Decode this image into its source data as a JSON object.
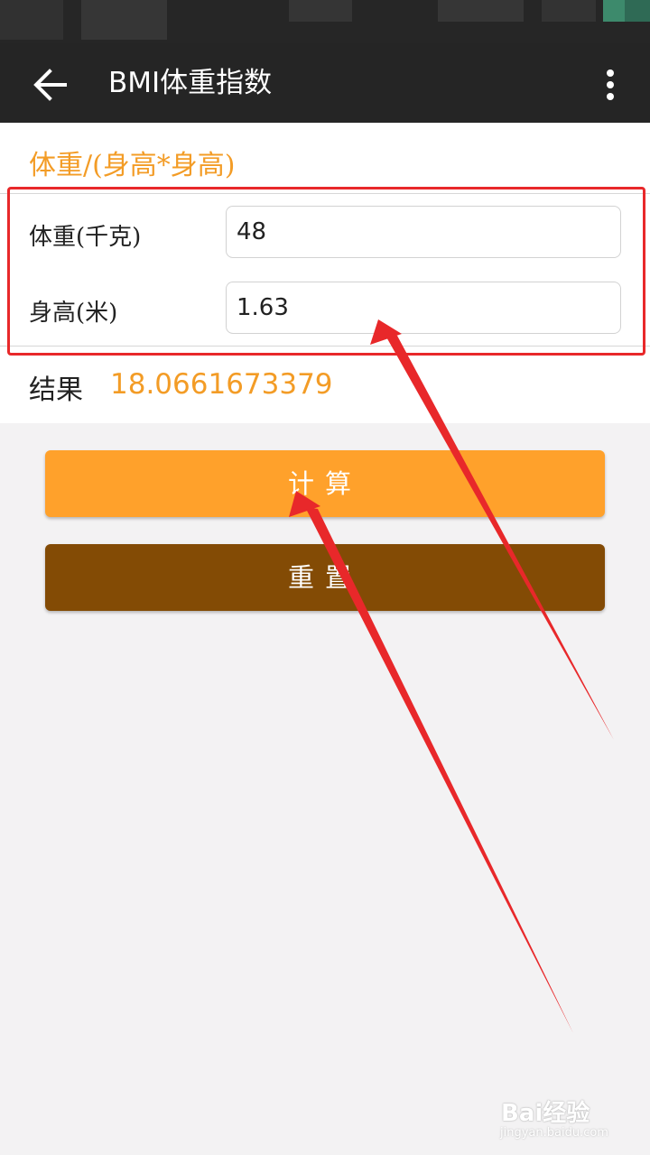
{
  "app": {
    "title": "BMI体重指数"
  },
  "form": {
    "formula": "体重/(身高*身高)",
    "weight_label": "体重(千克)",
    "weight_value": "48",
    "height_label": "身高(米)",
    "height_value": "1.63"
  },
  "result": {
    "label": "结果",
    "value": "18.0661673379"
  },
  "buttons": {
    "calculate_label": "计算",
    "reset_label": "重置"
  },
  "watermark": {
    "logo_text": "Bai经验",
    "sub_text": "jingyan.baidu.com"
  },
  "colors": {
    "appbar": "#252525",
    "accent": "#f39c26",
    "calculate_button": "#ffa12b",
    "reset_button": "#834b05",
    "annotation": "#e8282a"
  },
  "icons": {
    "back": "arrow-left-icon",
    "menu": "more-vertical-icon"
  }
}
